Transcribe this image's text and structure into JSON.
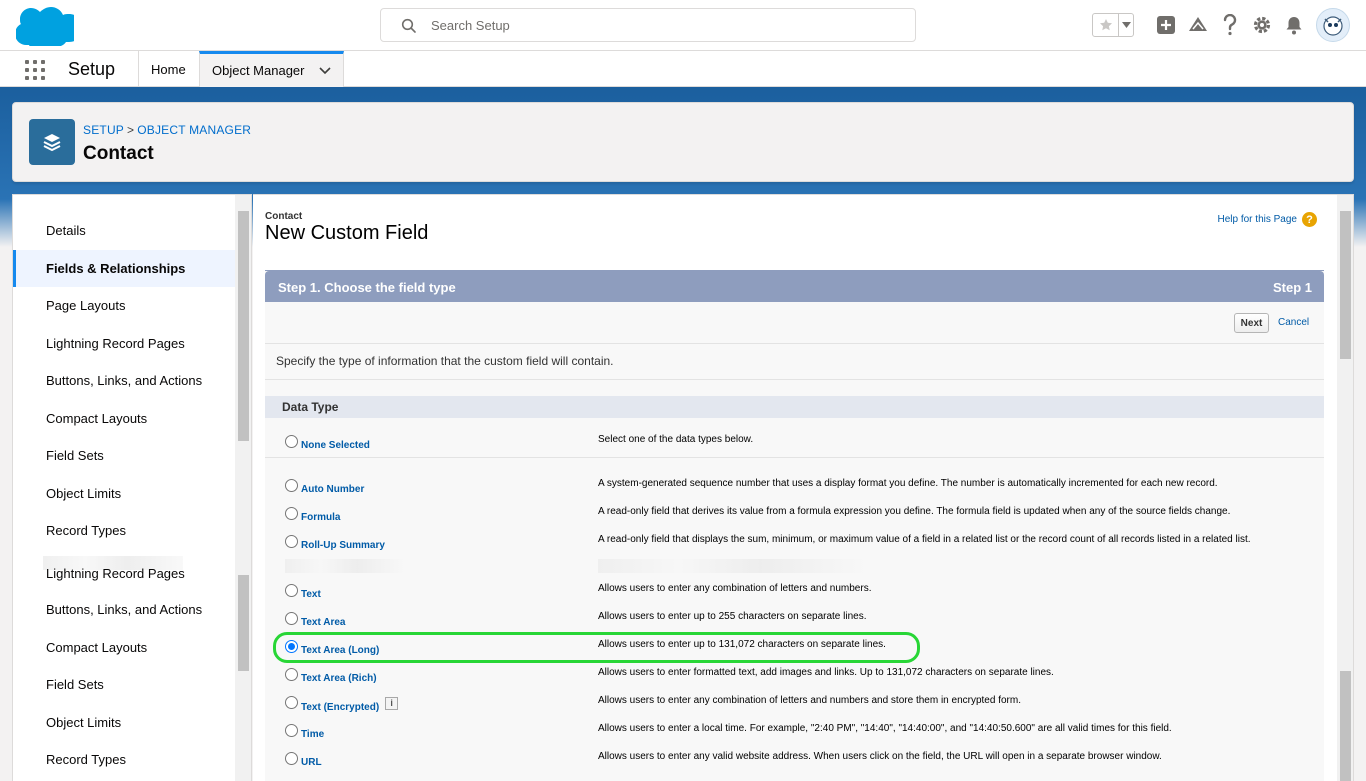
{
  "header": {
    "search_placeholder": "Search Setup",
    "icons": [
      "salesforce-cloud-logo",
      "star-icon",
      "add-icon",
      "trailhead-icon",
      "help-icon",
      "gear-icon",
      "bell-icon",
      "avatar"
    ]
  },
  "nav": {
    "app_name": "Setup",
    "tabs": [
      {
        "label": "Home"
      },
      {
        "label": "Object Manager",
        "active": true
      }
    ]
  },
  "page_header": {
    "breadcrumb_setup": "SETUP",
    "breadcrumb_sep": ">",
    "breadcrumb_object_manager": "OBJECT MANAGER",
    "title": "Contact"
  },
  "sidebar": {
    "items": [
      {
        "label": "Details"
      },
      {
        "label": "Fields & Relationships",
        "active": true
      },
      {
        "label": "Page Layouts"
      },
      {
        "label": "Lightning Record Pages"
      },
      {
        "label": "Buttons, Links, and Actions"
      },
      {
        "label": "Compact Layouts"
      },
      {
        "label": "Field Sets"
      },
      {
        "label": "Object Limits"
      },
      {
        "label": "Record Types"
      },
      {
        "label": "Lightning Record Pages"
      },
      {
        "label": "Buttons, Links, and Actions"
      },
      {
        "label": "Compact Layouts"
      },
      {
        "label": "Field Sets"
      },
      {
        "label": "Object Limits"
      },
      {
        "label": "Record Types"
      }
    ]
  },
  "main": {
    "object_label": "Contact",
    "title": "New Custom Field",
    "help_link": "Help for this Page",
    "help_icon": "?",
    "step_title": "Step 1. Choose the field type",
    "step_num": "Step 1",
    "next_label": "Next",
    "cancel_label": "Cancel",
    "description": "Specify the type of information that the custom field will contain.",
    "data_type_header": "Data Type",
    "info_glyph": "i",
    "data_types": [
      {
        "name": "None Selected",
        "desc": "Select one of the data types below.",
        "selected": false
      },
      {
        "name": "Auto Number",
        "desc": "A system-generated sequence number that uses a display format you define. The number is automatically incremented for each new record.",
        "selected": false
      },
      {
        "name": "Formula",
        "desc": "A read-only field that derives its value from a formula expression you define. The formula field is updated when any of the source fields change.",
        "selected": false
      },
      {
        "name": "Roll-Up Summary",
        "desc": "A read-only field that displays the sum, minimum, or maximum value of a field in a related list or the record count of all records listed in a related list.",
        "selected": false
      },
      {
        "name": "Text",
        "desc": "Allows users to enter any combination of letters and numbers.",
        "selected": false
      },
      {
        "name": "Text Area",
        "desc": "Allows users to enter up to 255 characters on separate lines.",
        "selected": false
      },
      {
        "name": "Text Area (Long)",
        "desc": "Allows users to enter up to 131,072 characters on separate lines.",
        "selected": true
      },
      {
        "name": "Text Area (Rich)",
        "desc": "Allows users to enter formatted text, add images and links. Up to 131,072 characters on separate lines.",
        "selected": false
      },
      {
        "name": "Text (Encrypted)",
        "desc": "Allows users to enter any combination of letters and numbers and store them in encrypted form.",
        "selected": false
      },
      {
        "name": "Time",
        "desc": "Allows users to enter a local time. For example, \"2:40 PM\", \"14:40\", \"14:40:00\", and \"14:40:50.600\" are all valid times for this field.",
        "selected": false
      },
      {
        "name": "URL",
        "desc": "Allows users to enter any valid website address. When users click on the field, the URL will open in a separate browser window.",
        "selected": false
      }
    ]
  },
  "colors": {
    "brand_blue": "#1589ee",
    "step_header": "#8e9dbe",
    "highlight_green": "#28d636",
    "link": "#015ba7"
  }
}
